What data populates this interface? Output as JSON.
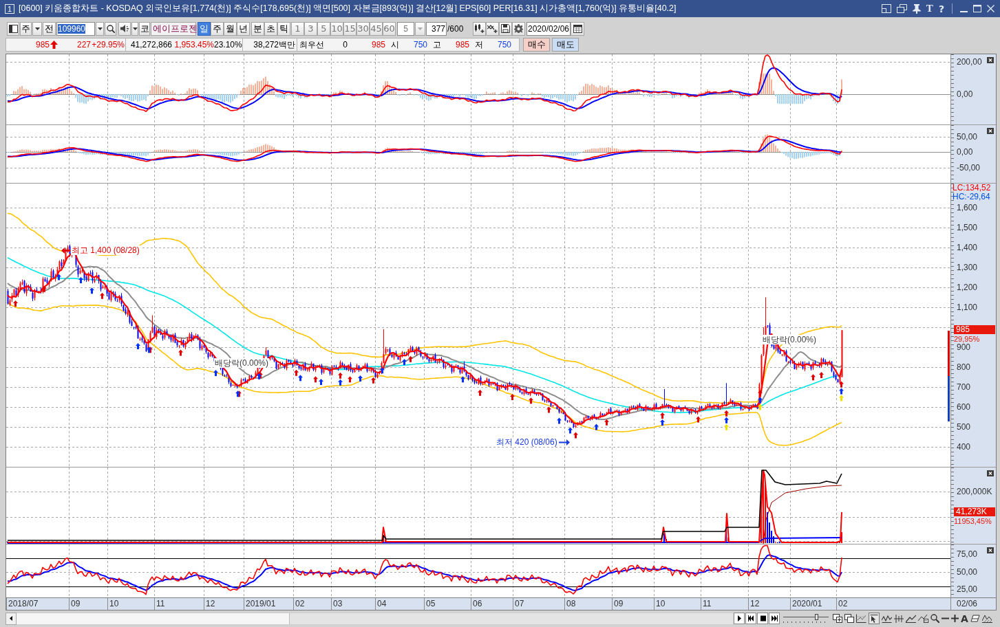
{
  "window": {
    "number": "1",
    "title": "[0600] 키움종합차트 - KOSDAQ 외국인보유[1,774(천)] 주식수[178,695(천)] 액면[500] 자본금[893(억)] 결산[12월] EPS[60] PER[16.31] 시가총액[1,760(억)] 유통비율[40.2]",
    "tool_glyphs": [
      {
        "kind": "font",
        "label": "T"
      },
      {
        "kind": "help",
        "label": "?"
      }
    ]
  },
  "toolbar": {
    "market_button": "주",
    "scope_button": "전",
    "code_field": {
      "value": "109960",
      "text_selected": true
    },
    "market_tag": "코",
    "stock_name": "에이프로젠",
    "periods": [
      {
        "label": "일",
        "selected": true
      },
      {
        "label": "주",
        "selected": false
      },
      {
        "label": "월",
        "selected": false
      },
      {
        "label": "년",
        "selected": false
      }
    ],
    "intraday_periods": [
      {
        "label": "분",
        "selected": false
      },
      {
        "label": "초",
        "selected": false
      },
      {
        "label": "틱",
        "selected": false
      }
    ],
    "intervals": [
      {
        "label": "1",
        "disabled": true
      },
      {
        "label": "3",
        "disabled": true
      },
      {
        "label": "5",
        "disabled": true
      },
      {
        "label": "10",
        "disabled": true
      },
      {
        "label": "15",
        "disabled": true
      },
      {
        "label": "30",
        "disabled": true
      },
      {
        "label": "45",
        "disabled": true
      },
      {
        "label": "60",
        "disabled": true
      }
    ],
    "interval_field": {
      "value": "5",
      "disabled": true
    },
    "count_field": {
      "value": "377",
      "limit": "/600"
    },
    "date_field": {
      "value": "2020/02/06"
    }
  },
  "quote": {
    "price": "985",
    "rising": true,
    "change": "227",
    "change_rate": "+29.95%",
    "volume": "41,272,866",
    "volume_rate": "1,953.45%",
    "turnover_rate": "23.10%",
    "amount": "38,272백만",
    "best_label": "최우선",
    "best_quantity": "0",
    "best_price": "985",
    "open_label": "시",
    "open": "750",
    "high_label": "고",
    "high": "985",
    "low_label": "저",
    "low": "750"
  },
  "order_buttons": [
    {
      "kind": "buy",
      "label": "매수"
    },
    {
      "kind": "sell",
      "label": "매도"
    }
  ],
  "panes": [
    {
      "kind": "macd_fast",
      "closable": true,
      "axis_labels": [
        "200,00",
        "0,00"
      ]
    },
    {
      "kind": "macd_slow",
      "closable": true,
      "axis_labels": [
        "50,00",
        "0,00",
        "-50,00"
      ]
    },
    {
      "kind": "price",
      "closable": false,
      "legend": [
        {
          "text": "LC:134,52",
          "color": "#ff0000"
        },
        {
          "text": "HC:-29,64",
          "color": "#0050e0"
        }
      ],
      "axis_labels": [
        "1,600",
        "1,500",
        "1,400",
        "1,300",
        "1,200",
        "1,100",
        "900",
        "800",
        "700",
        "600",
        "500",
        "400"
      ],
      "last_value": {
        "value": "985",
        "rate": "29,95%"
      },
      "annotations": [
        {
          "kind": "high",
          "text": "최고 1,400 (08/28)"
        },
        {
          "kind": "ex_dividend",
          "text": "배당락(0.00%)"
        },
        {
          "kind": "ex_dividend",
          "text": "배당락(0.00%)"
        },
        {
          "kind": "low",
          "text": "최저 420 (08/06)"
        }
      ]
    },
    {
      "kind": "volume",
      "closable": true,
      "axis_labels": [
        "200,000K"
      ],
      "last_value": {
        "value": "41,273K",
        "rate": "11953,45%"
      }
    },
    {
      "kind": "rsi",
      "closable": true,
      "axis_labels": [
        "75,00",
        "50,00",
        "25,00"
      ]
    }
  ],
  "x_axis": {
    "labels": [
      "2018/07",
      "09",
      "10",
      "11",
      "12",
      "2019/01",
      "02",
      "03",
      "04",
      "05",
      "06",
      "07",
      "08",
      "09",
      "10",
      "11",
      "12",
      "2020/01",
      "02"
    ],
    "cursor_label": "02/06"
  },
  "chart_tools": {
    "zoom_slider": {
      "level": 0.72
    },
    "cursor_tool_selected": true,
    "text_tool": "A"
  }
}
